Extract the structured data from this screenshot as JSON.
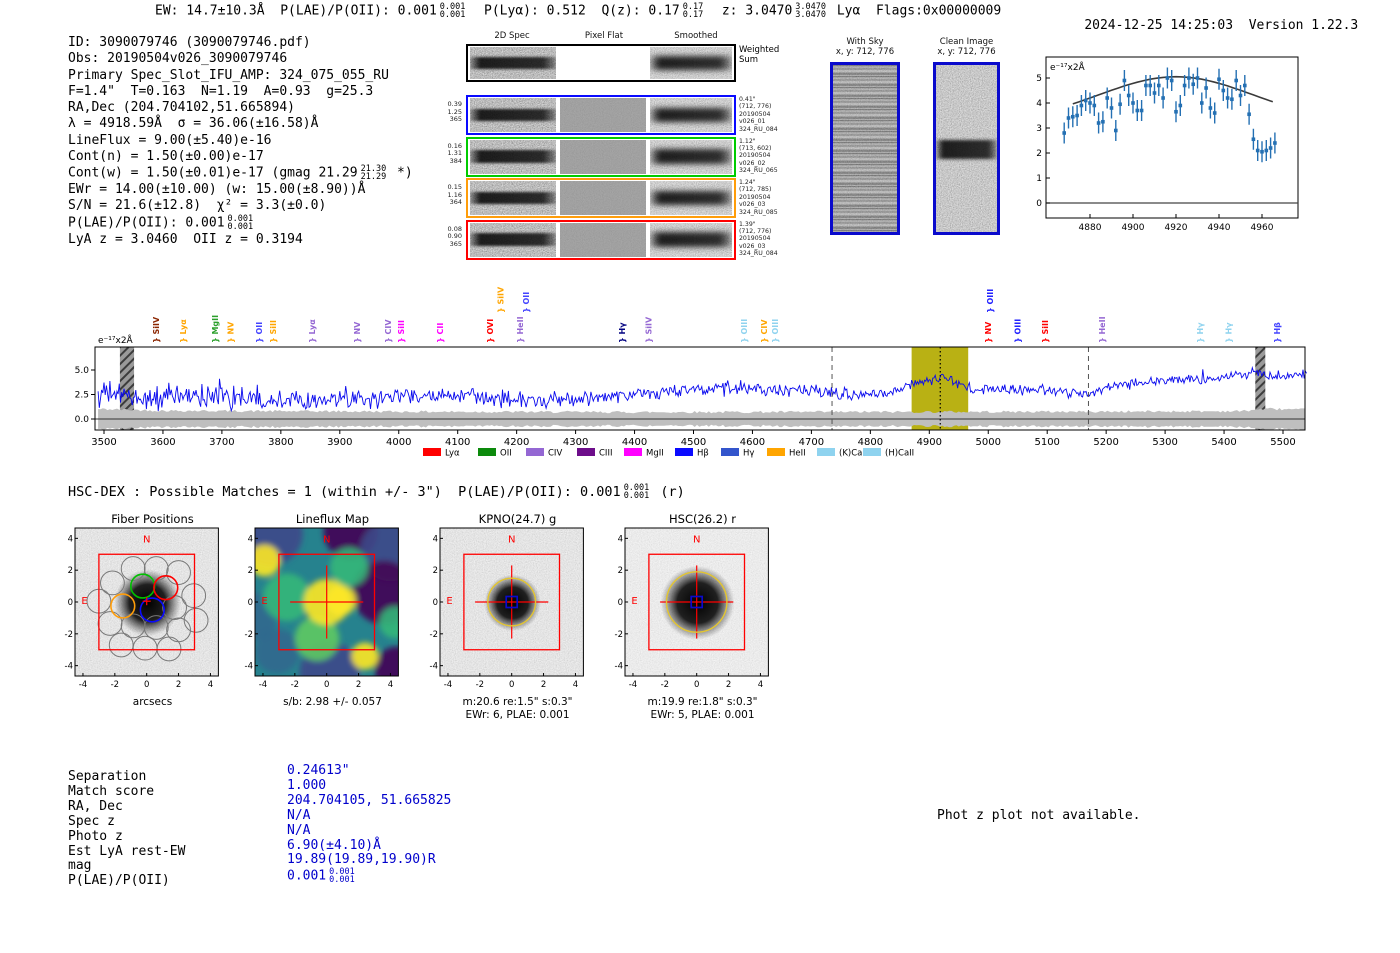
{
  "header": {
    "segments": [
      {
        "t": "EW: 14.7±10.3Å  "
      },
      {
        "t": "P(LAE)/P(OII): 0.001"
      },
      {
        "stack": [
          "0.001",
          "0.001"
        ]
      },
      {
        "t": "  P(Lyα): 0.512  "
      },
      {
        "t": "Q(z): 0.17"
      },
      {
        "stack": [
          "0.17",
          "0.17"
        ]
      },
      {
        "t": "  z: 3.0470"
      },
      {
        "stack": [
          "3.0470",
          "3.0470"
        ]
      },
      {
        "t": " Lyα  Flags:0x00000009"
      }
    ],
    "datetime": "2024-12-25 14:25:03",
    "version": "Version 1.22.3"
  },
  "info": {
    "lines": [
      {
        "segs": [
          {
            "t": "ID: 3090079746 (3090079746.pdf)"
          }
        ]
      },
      {
        "segs": [
          {
            "t": "Obs: 20190504v026_3090079746"
          }
        ]
      },
      {
        "segs": [
          {
            "t": "Primary Spec_Slot_IFU_AMP: 324_075_055_RU"
          }
        ]
      },
      {
        "segs": [
          {
            "t": "F=1.4\"  T=0.163  N=1.19  A=0.93  g=25.3"
          }
        ]
      },
      {
        "segs": [
          {
            "t": "RA,Dec (204.704102,51.665894)"
          }
        ]
      },
      {
        "segs": [
          {
            "t": "λ = 4918.59Å  σ = 36.06(±16.58)Å"
          }
        ]
      },
      {
        "segs": [
          {
            "t": "LineFlux = 9.00(±5.40)e-16"
          }
        ]
      },
      {
        "segs": [
          {
            "t": "Cont(n) = 1.50(±0.00)e-17"
          }
        ]
      },
      {
        "segs": [
          {
            "t": "Cont(w) = 1.50(±0.01)e-17 (gmag 21.29"
          },
          {
            "stack": [
              "21.30",
              "21.29"
            ]
          },
          {
            "t": " *)"
          }
        ]
      },
      {
        "segs": [
          {
            "t": "EWr = 14.00(±10.00) (w: 15.00(±8.90))Å"
          }
        ]
      },
      {
        "segs": [
          {
            "t": "S/N = 21.6(±12.8)  χ² = 3.3(±0.0)"
          }
        ]
      },
      {
        "segs": [
          {
            "t": "P(LAE)/P(OII): 0.001"
          },
          {
            "stack": [
              "0.001",
              "0.001"
            ]
          }
        ]
      },
      {
        "segs": [
          {
            "t": "LyA z = 3.0460  OII z = 0.3194"
          }
        ]
      }
    ]
  },
  "spec2d": {
    "col_titles": [
      "2D Spec",
      "Pixel Flat",
      "Smoothed"
    ],
    "rows": [
      {
        "border": "#000000",
        "left": [],
        "right": [
          "Weighted",
          "Sum"
        ],
        "big_right": true,
        "flat_blank": true
      },
      {
        "border": "#0a0aff",
        "left": [
          "0.39",
          "1.25",
          "365"
        ],
        "right": [
          "0.41\"",
          "(712, 776)",
          "20190504",
          "v026_01",
          "324_RU_084"
        ]
      },
      {
        "border": "#00cc00",
        "left": [
          "0.16",
          "1.31",
          "384"
        ],
        "right": [
          "1.12\"",
          "(713, 602)",
          "20190504",
          "v026_02",
          "324_RU_065"
        ]
      },
      {
        "border": "#ff9d0a",
        "left": [
          "0.15",
          "1.16",
          "364"
        ],
        "right": [
          "1.24\"",
          "(712, 785)",
          "20190504",
          "v026_03",
          "324_RU_085"
        ]
      },
      {
        "border": "#ff0000",
        "left": [
          "0.08",
          "0.90",
          "365"
        ],
        "right": [
          "1.39\"",
          "(712, 776)",
          "20190504",
          "v026_03",
          "324_RU_084"
        ]
      }
    ]
  },
  "sky_panels": {
    "with_sky": {
      "title": "With Sky",
      "subtitle": "x, y: 712, 776"
    },
    "clean": {
      "title": "Clean Image",
      "subtitle": "x, y: 712, 776"
    }
  },
  "match_heading": {
    "segments": [
      {
        "t": "HSC-DEX : Possible Matches = 1 (within +/- 3\")  P(LAE)/P(OII): 0.001"
      },
      {
        "stack": [
          "0.001",
          "0.001"
        ]
      },
      {
        "t": " (r)"
      }
    ]
  },
  "chart_data": [
    {
      "id": "line_fit_plot",
      "type": "scatter",
      "ylabel_inside": "e⁻¹⁷x2Å",
      "x_ticks": [
        4880,
        4900,
        4920,
        4940,
        4960
      ],
      "y_ticks": [
        0,
        1,
        2,
        3,
        4,
        5
      ],
      "xlim": [
        4859,
        4977
      ],
      "ylim": [
        -0.6,
        5.85
      ],
      "x_start": 4868,
      "x_step": 2,
      "values": [
        2.8,
        3.4,
        3.45,
        3.5,
        3.9,
        4.1,
        4.0,
        3.9,
        3.2,
        3.25,
        4.2,
        3.8,
        2.9,
        3.95,
        4.9,
        4.3,
        4.0,
        3.7,
        3.7,
        4.7,
        4.7,
        4.4,
        4.7,
        4.2,
        5.0,
        4.9,
        3.65,
        3.9,
        4.7,
        5.0,
        4.75,
        5.0,
        4.0,
        4.6,
        3.8,
        3.6,
        4.95,
        4.5,
        4.2,
        4.15,
        4.9,
        4.3,
        4.7,
        3.55,
        2.55,
        2.1,
        2.05,
        2.1,
        2.2,
        2.4
      ],
      "yerr": 0.42,
      "fit": {
        "center": 4920,
        "sigma": 36.06,
        "amplitude": 1.85,
        "continuum": 3.2,
        "x_range": [
          4872,
          4966
        ]
      },
      "marker_color": "#2470b3",
      "fit_color": "#3a3a3a"
    },
    {
      "id": "full_spectrum",
      "type": "line",
      "ylabel_inside": "e⁻¹⁷x2Å",
      "x_ticks": [
        3500,
        3600,
        3700,
        3800,
        3900,
        4000,
        4100,
        4200,
        4300,
        4400,
        4500,
        4600,
        4700,
        4800,
        4900,
        5000,
        5100,
        5200,
        5300,
        5400,
        5500
      ],
      "y_tick_labels": [
        "5.0",
        "2.5",
        "0.0"
      ],
      "y_tick_vals": [
        5.0,
        2.5,
        0.0
      ],
      "xlim": [
        3485,
        5541
      ],
      "ylim": [
        -1.12,
        7.35
      ],
      "continuum_anchors_x": [
        3500,
        3550,
        3600,
        3650,
        3700,
        3750,
        3800,
        3850,
        3900,
        3950,
        4000,
        4050,
        4100,
        4150,
        4200,
        4250,
        4300,
        4350,
        4400,
        4450,
        4500,
        4550,
        4600,
        4650,
        4700,
        4750,
        4800,
        4850,
        4880,
        4900,
        4918,
        4940,
        4960,
        4980,
        5000,
        5050,
        5100,
        5150,
        5180,
        5200,
        5250,
        5300,
        5350,
        5400,
        5440,
        5460,
        5480,
        5510,
        5540
      ],
      "continuum_anchors_y": [
        2.6,
        2.2,
        2.1,
        2.4,
        2.3,
        2.1,
        2.1,
        2.0,
        1.9,
        1.9,
        2.4,
        2.4,
        2.2,
        2.1,
        2.1,
        1.7,
        2.1,
        2.3,
        2.4,
        2.8,
        2.9,
        3.1,
        3.2,
        2.9,
        2.9,
        2.5,
        2.6,
        3.0,
        3.7,
        3.9,
        4.1,
        3.9,
        3.3,
        2.9,
        3.0,
        3.0,
        2.9,
        2.7,
        2.6,
        3.3,
        3.8,
        3.9,
        4.1,
        4.3,
        4.6,
        4.9,
        4.2,
        4.5,
        4.6
      ],
      "noise_amp_anchors_x": [
        3500,
        3700,
        3900,
        4100,
        4300,
        4500,
        4700,
        4900,
        5100,
        5300,
        5540
      ],
      "noise_amp_anchors_y": [
        1.3,
        1.2,
        0.9,
        0.85,
        0.8,
        0.7,
        0.65,
        0.55,
        0.55,
        0.5,
        0.5
      ],
      "err_band_anchors_x": [
        3500,
        3600,
        3800,
        4000,
        4400,
        4800,
        5200,
        5430,
        5470,
        5540
      ],
      "err_band_anchors_y": [
        1.0,
        0.85,
        0.8,
        0.75,
        0.7,
        0.72,
        0.75,
        0.8,
        1.05,
        0.95
      ],
      "detection_line_x": 4918.59,
      "highlight_band": [
        4870,
        4966
      ],
      "dashed_lines": [
        4735,
        5170
      ],
      "hatched_bands": [
        [
          3527,
          3551
        ],
        [
          5453,
          5470
        ]
      ],
      "line_color": "#0a0aee",
      "band_color": "#bfbfbf",
      "highlight_color": "#b3aa00",
      "legend": [
        {
          "label": "Lyα",
          "color": "#ff0000"
        },
        {
          "label": "OII",
          "color": "#0c8a0c"
        },
        {
          "label": "CIV",
          "color": "#9467d3"
        },
        {
          "label": "CIII",
          "color": "#6d0d8a"
        },
        {
          "label": "MgII",
          "color": "#ff00ff"
        },
        {
          "label": "Hβ",
          "color": "#0a0aff"
        },
        {
          "label": "Hγ",
          "color": "#3355cc"
        },
        {
          "label": "HeII",
          "color": "#ffa500"
        },
        {
          "label": "(K)CaII",
          "color": "#8fd3ef"
        },
        {
          "label": "(H)CaII",
          "color": "#8fd3ef"
        }
      ],
      "line_markers": [
        {
          "label": "SiIV",
          "x": 3593,
          "color": "#8b2500",
          "tier": 0
        },
        {
          "label": "Lyα",
          "x": 3639,
          "color": "#ffa500",
          "tier": 0
        },
        {
          "label": "MgII",
          "x": 3693,
          "color": "#2ca02c",
          "tier": 0
        },
        {
          "label": "NV",
          "x": 3720,
          "color": "#ffa500",
          "tier": 0
        },
        {
          "label": "OII",
          "x": 3768,
          "color": "#4444ff",
          "tier": 0
        },
        {
          "label": "SiII",
          "x": 3792,
          "color": "#ffa500",
          "tier": 0
        },
        {
          "label": "Lyα",
          "x": 3858,
          "color": "#9467d3",
          "tier": 0
        },
        {
          "label": "NV",
          "x": 3934,
          "color": "#9467d3",
          "tier": 0
        },
        {
          "label": "CIV",
          "x": 3987,
          "color": "#9467d3",
          "tier": 0
        },
        {
          "label": "SiII",
          "x": 4009,
          "color": "#ff00ff",
          "tier": 0
        },
        {
          "label": "CII",
          "x": 4075,
          "color": "#ff00ff",
          "tier": 0
        },
        {
          "label": "OVI",
          "x": 4160,
          "color": "#ff0000",
          "tier": 0
        },
        {
          "label": "SiIV",
          "x": 4178,
          "color": "#ffa500",
          "tier": 1
        },
        {
          "label": "HeII",
          "x": 4211,
          "color": "#9467d3",
          "tier": 0
        },
        {
          "label": "OII",
          "x": 4221,
          "color": "#4444ff",
          "tier": 1
        },
        {
          "label": "Hγ",
          "x": 4384,
          "color": "#000080",
          "tier": 0
        },
        {
          "label": "SiIV",
          "x": 4429,
          "color": "#9467d3",
          "tier": 0
        },
        {
          "label": "OIII",
          "x": 4591,
          "color": "#8fd3ef",
          "tier": 0
        },
        {
          "label": "CIV",
          "x": 4625,
          "color": "#ffa500",
          "tier": 0
        },
        {
          "label": "OIII",
          "x": 4643,
          "color": "#8fd3ef",
          "tier": 0
        },
        {
          "label": "NV",
          "x": 5005,
          "color": "#ff0000",
          "tier": 0
        },
        {
          "label": "OIII",
          "x": 5008,
          "color": "#2222ff",
          "tier": 1
        },
        {
          "label": "OIII",
          "x": 5055,
          "color": "#2222ff",
          "tier": 0
        },
        {
          "label": "SiII",
          "x": 5101,
          "color": "#ff0000",
          "tier": 0
        },
        {
          "label": "HeII",
          "x": 5198,
          "color": "#9467d3",
          "tier": 0
        },
        {
          "label": "Hγ",
          "x": 5364,
          "color": "#8fd3ef",
          "tier": 0
        },
        {
          "label": "Hγ",
          "x": 5413,
          "color": "#8fd3ef",
          "tier": 0
        },
        {
          "label": "Hβ",
          "x": 5495,
          "color": "#4444ff",
          "tier": 0
        }
      ]
    }
  ],
  "cutouts": {
    "tick_labels": [
      "-4",
      "-2",
      "0",
      "2",
      "4"
    ],
    "north_label": "N",
    "east_label": "E",
    "panels": [
      {
        "type": "fiber",
        "title": "Fiber Positions",
        "caption1": "arcsecs",
        "caption2": ""
      },
      {
        "type": "lineflux",
        "title": "Lineflux Map",
        "caption1": "s/b: 2.98 +/- 0.057",
        "caption2": ""
      },
      {
        "type": "image",
        "title": "KPNO(24.7) g",
        "caption1": "m:20.6  re:1.5\"  s:0.3\"",
        "caption2": "EWr: 6, PLAE: 0.001",
        "blob_r": 1.15,
        "circle_r": 1.5
      },
      {
        "type": "image",
        "title": "HSC(26.2) r",
        "caption1": "m:19.9  re:1.8\"  s:0.3\"",
        "caption2": "EWr: 5, PLAE: 0.001",
        "blob_r": 1.5,
        "circle_r": 1.9
      }
    ]
  },
  "match_table": {
    "value_color": "#0000cc",
    "rows": [
      {
        "label": "Separation",
        "value": "0.24613\""
      },
      {
        "label": "Match score",
        "value": "1.000"
      },
      {
        "label": "RA, Dec",
        "value": "204.704105, 51.665825"
      },
      {
        "label": "Spec z",
        "value": "N/A"
      },
      {
        "label": "Photo z",
        "value": "N/A"
      },
      {
        "label": "Est LyA rest-EW",
        "value": "6.90(±4.10)Å"
      },
      {
        "label": "mag",
        "value": "19.89(19.89,19.90)R"
      },
      {
        "label": "P(LAE)/P(OII)",
        "value": "0.001",
        "stack": [
          "0.001",
          "0.001"
        ]
      }
    ]
  },
  "phot_z_notice": "Phot z plot not available."
}
